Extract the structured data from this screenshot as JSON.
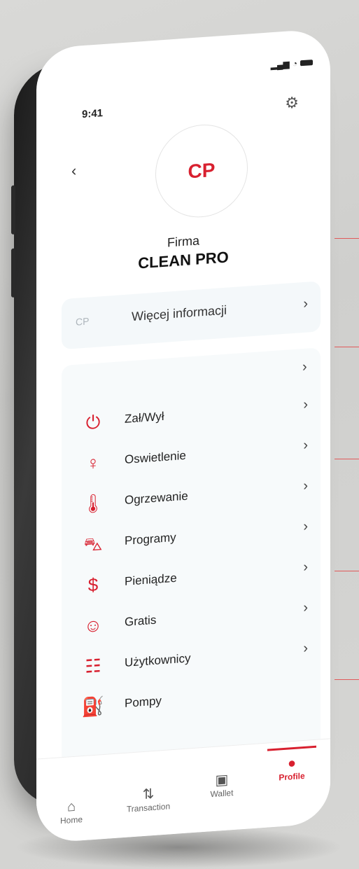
{
  "status": {
    "time": "9:41"
  },
  "header": {
    "avatar_text": "CP",
    "company_label": "Firma",
    "company_name": "CLEAN PRO"
  },
  "more_info": {
    "badge": "CP",
    "label": "Więcej informacji"
  },
  "menu": [
    {
      "label": "Zał/Wył",
      "icon": "power-icon"
    },
    {
      "label": "Oswietlenie",
      "icon": "lightbulb-icon"
    },
    {
      "label": "Ogrzewanie",
      "icon": "thermometer-icon"
    },
    {
      "label": "Programy",
      "icon": "car-icon"
    },
    {
      "label": "Pieniądze",
      "icon": "dollar-icon"
    },
    {
      "label": "Gratis",
      "icon": "smile-icon"
    },
    {
      "label": "Użytkownicy",
      "icon": "contacts-icon"
    },
    {
      "label": "Pompy",
      "icon": "pump-icon"
    }
  ],
  "tabbar": {
    "home": "Home",
    "transaction": "Transaction",
    "wallet": "Wallet",
    "profile": "Profile",
    "active": "profile"
  },
  "colors": {
    "accent": "#d8202f",
    "card_bg": "#f4f8fa"
  }
}
